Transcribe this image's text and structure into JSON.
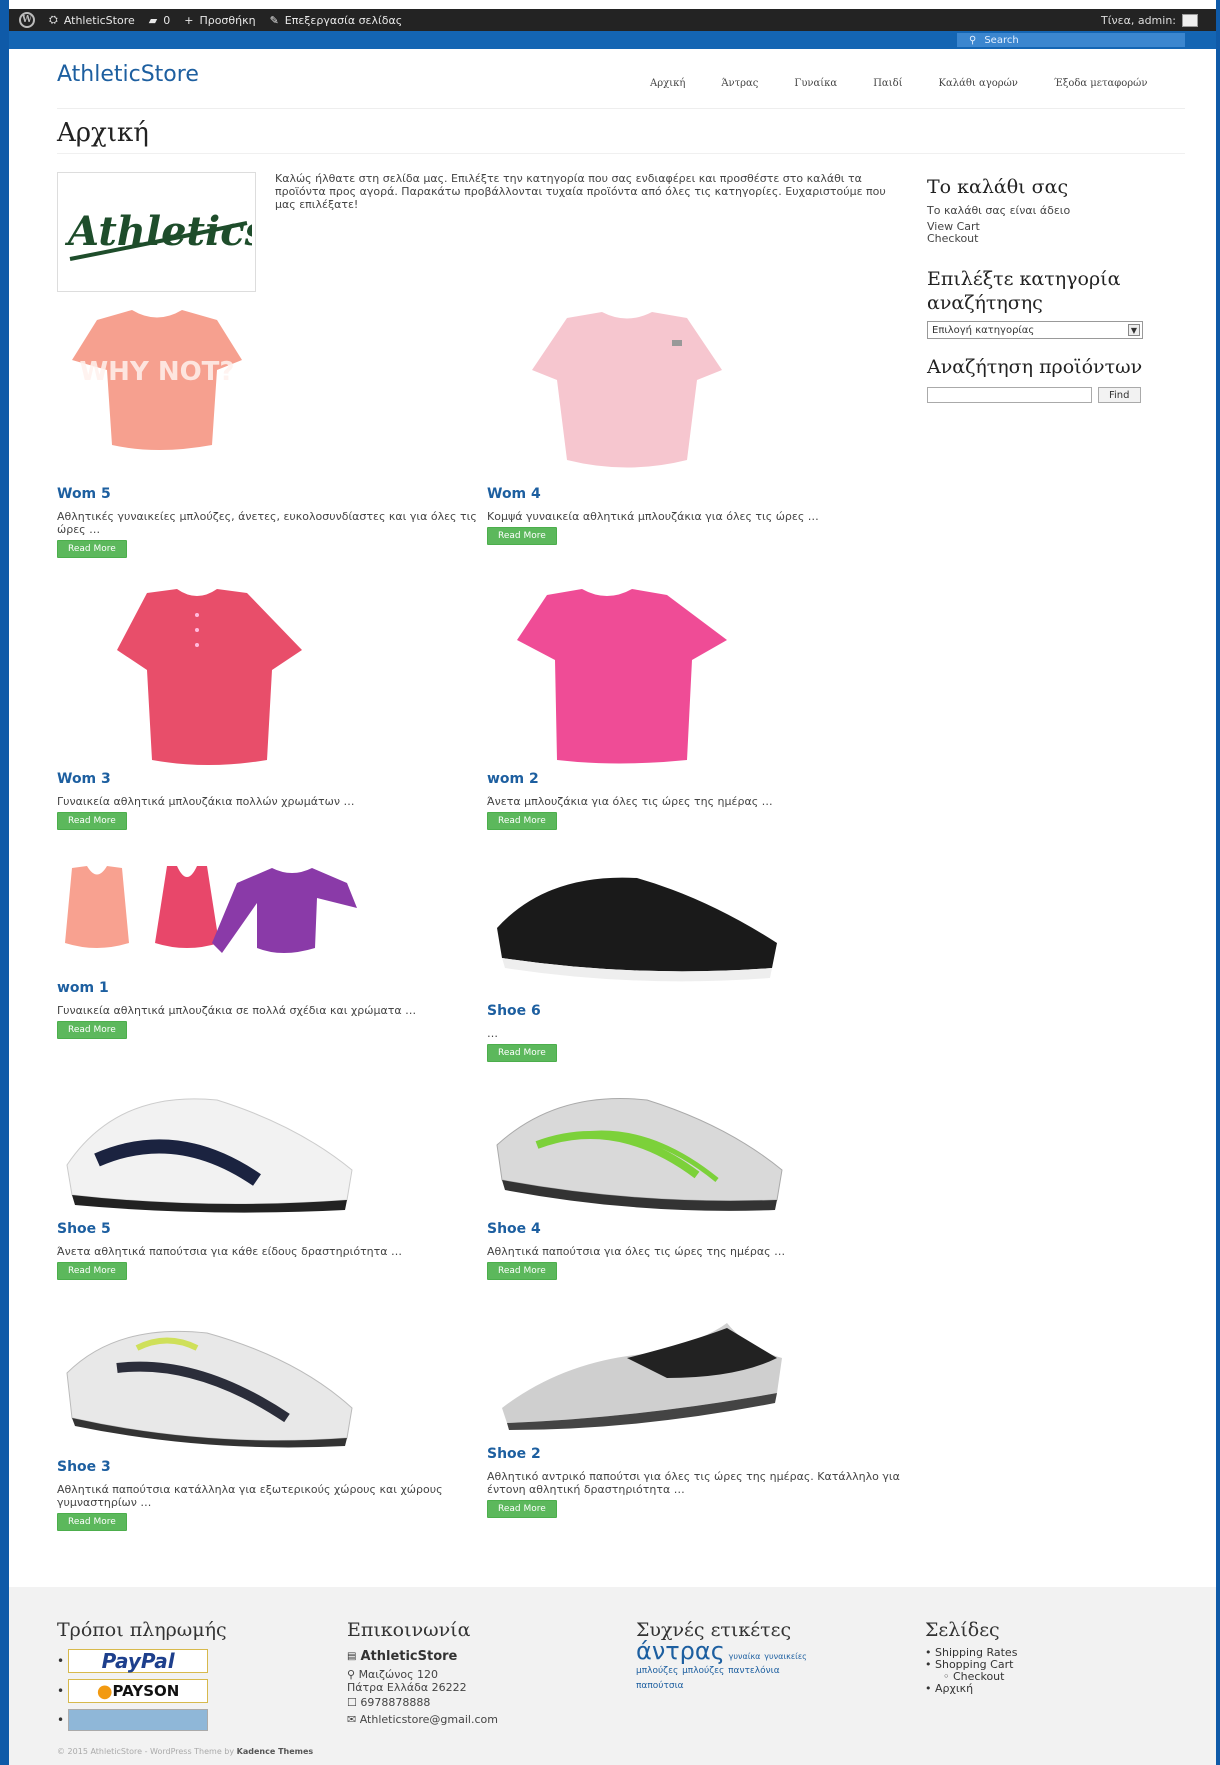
{
  "adminbar": {
    "site": "AthleticStore",
    "comments": "0",
    "new": "Προσθήκη",
    "edit": "Επεξεργασία σελίδας",
    "greeting": "Τίνεα, admin:"
  },
  "search": {
    "placeholder": "Search"
  },
  "header": {
    "site_title": "AthleticStore",
    "nav": [
      "Αρχική",
      "Άντρας",
      "Γυναίκα",
      "Παιδί",
      "Καλάθι αγορών",
      "Έξοδα μεταφορών"
    ]
  },
  "page": {
    "title": "Αρχική",
    "logo_text": "Athletics",
    "intro": "Καλώς ήλθατε στη σελίδα μας. Επιλέξτε την κατηγορία που σας ενδιαφέρει και προσθέστε στο καλάθι τα προϊόντα προς αγορά. Παρακάτω προβάλλονται τυχαία προϊόντα από όλες τις κατηγορίες. Ευχαριστούμε που μας επιλέξατε!"
  },
  "products": [
    {
      "title": "Wom 5",
      "desc": "Αθλητικές γυναικείες μπλούζες, άνετες, ευκολοσυνδίαστες και για όλες τις ώρες …",
      "button": "Read More",
      "shirt_text": "WHY NOT?"
    },
    {
      "title": "Wom 4",
      "desc": "Κομψά γυναικεία αθλητικά μπλουζάκια για όλες τις ώρες …",
      "button": "Read More"
    },
    {
      "title": "Wom 3",
      "desc": "Γυναικεία αθλητικά μπλουζάκια πολλών χρωμάτων …",
      "button": "Read More"
    },
    {
      "title": "wom 2",
      "desc": "Άνετα μπλουζάκια για όλες τις ώρες της ημέρας …",
      "button": "Read More"
    },
    {
      "title": "wom 1",
      "desc": "Γυναικεία αθλητικά μπλουζάκια σε πολλά σχέδια και χρώματα …",
      "button": "Read More"
    },
    {
      "title": "Shoe 6",
      "desc": "…",
      "button": "Read More"
    },
    {
      "title": "Shoe 5",
      "desc": "Άνετα αθλητικά παπούτσια για κάθε είδους δραστηριότητα …",
      "button": "Read More"
    },
    {
      "title": "Shoe 4",
      "desc": "Αθλητικά παπούτσια για όλες τις ώρες της ημέρας …",
      "button": "Read More"
    },
    {
      "title": "Shoe 3",
      "desc": "Αθλητικά παπούτσια κατάλληλα για εξωτερικούς χώρους και χώρους γυμναστηρίων …",
      "button": "Read More"
    },
    {
      "title": "Shoe 2",
      "desc": "Αθλητικό αντρικό παπούτσι για όλες τις ώρες της ημέρας. Κατάλληλο για έντονη αθλητική δραστηριότητα …",
      "button": "Read More"
    }
  ],
  "sidebar": {
    "cart_title": "Το καλάθι σας",
    "cart_empty": "Το καλάθι σας είναι άδειο",
    "view_cart": "View Cart",
    "checkout": "Checkout",
    "category_title": "Επιλέξτε κατηγορία αναζήτησης",
    "category_select": "Επιλογή κατηγορίας",
    "search_title": "Αναζήτηση προϊόντων",
    "find": "Find"
  },
  "footer": {
    "payments_title": "Τρόποι πληρωμής",
    "paypal": "PayPal",
    "payson": "PAYSON",
    "contact_title": "Επικοινωνία",
    "contact_name": "AthleticStore",
    "address1": "Μαιζώνος 120",
    "address2": "Πάτρα Ελλάδα 26222",
    "phone": "6978878888",
    "email": "Athleticstore@gmail.com",
    "tags_title": "Συχνές ετικέτες",
    "tag_big": "άντρας",
    "tags_small": [
      "γυναίκα",
      "γυναικείες",
      "μπλούζες",
      "μπλούζες",
      "παντελόνια",
      "παπούτσια"
    ],
    "pages_title": "Σελίδες",
    "pages": [
      "Shipping Rates",
      "Shopping Cart",
      "Checkout",
      "Αρχική"
    ],
    "copyright": "© 2015 AthleticStore - WordPress Theme by",
    "theme_author": "Kadence Themes"
  },
  "colors": {
    "frame": "#0f5aa8",
    "link": "#1d5fa0",
    "button": "#5cb85c"
  }
}
